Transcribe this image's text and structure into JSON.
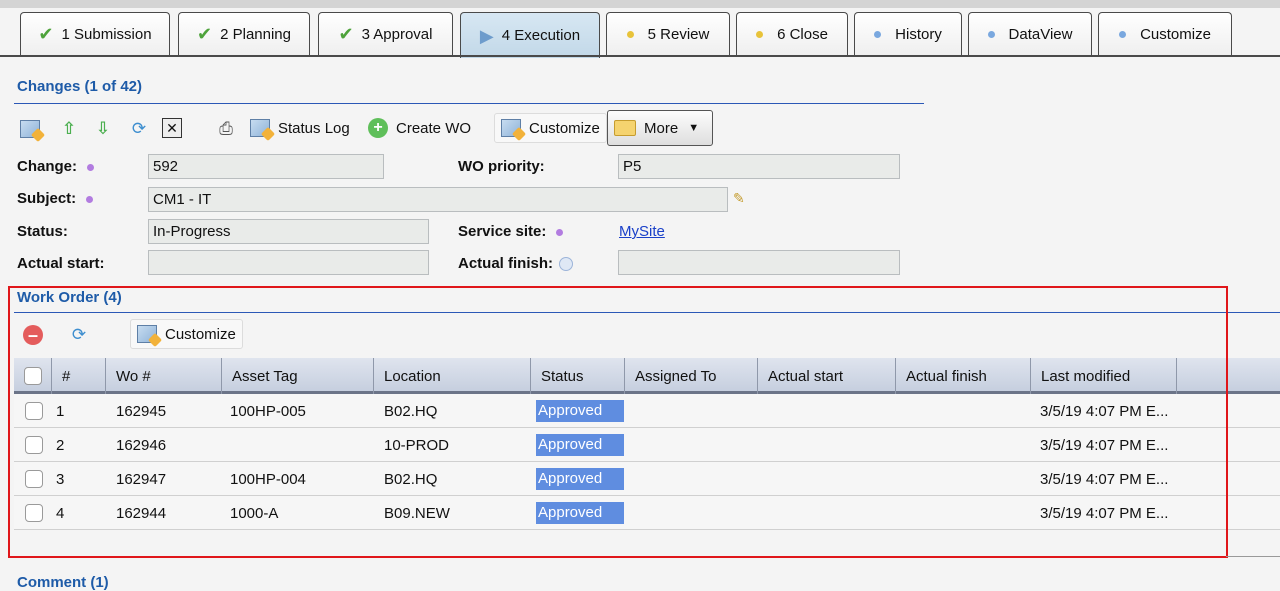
{
  "tabs": [
    {
      "label": "1 Submission",
      "icon": "check-icon"
    },
    {
      "label": "2 Planning",
      "icon": "check-icon"
    },
    {
      "label": "3 Approval",
      "icon": "check-icon"
    },
    {
      "label": "4 Execution",
      "icon": "play-icon"
    },
    {
      "label": "5 Review",
      "icon": "yellow-dot-icon"
    },
    {
      "label": "6 Close",
      "icon": "yellow-dot-icon"
    },
    {
      "label": "History",
      "icon": "blue-dot-icon"
    },
    {
      "label": "DataView",
      "icon": "blue-dot-icon"
    },
    {
      "label": "Customize",
      "icon": "blue-dot-icon"
    }
  ],
  "changes": {
    "title": "Changes (1 of 42)",
    "toolbar": {
      "status_log": "Status Log",
      "create_wo": "Create WO",
      "customize": "Customize",
      "more": "More"
    }
  },
  "form": {
    "change_label": "Change:",
    "change_value": "592",
    "wo_priority_label": "WO priority:",
    "wo_priority_value": "P5",
    "subject_label": "Subject:",
    "subject_value": "CM1 - IT",
    "status_label": "Status:",
    "status_value": "In-Progress",
    "service_site_label": "Service site:",
    "service_site_value": "MySite",
    "actual_start_label": "Actual start:",
    "actual_start_value": "",
    "actual_finish_label": "Actual finish:",
    "actual_finish_value": ""
  },
  "work_order": {
    "title": "Work Order (4)",
    "customize": "Customize",
    "columns": [
      "#",
      "Wo #",
      "Asset Tag",
      "Location",
      "Status",
      "Assigned To",
      "Actual start",
      "Actual finish",
      "Last modified"
    ],
    "rows": [
      {
        "num": "1",
        "wo": "162945",
        "asset": "100HP-005",
        "location": "B02.HQ",
        "status": "Approved",
        "assigned": "",
        "start": "",
        "finish": "",
        "modified": "3/5/19 4:07 PM E..."
      },
      {
        "num": "2",
        "wo": "162946",
        "asset": "",
        "location": "10-PROD",
        "status": "Approved",
        "assigned": "",
        "start": "",
        "finish": "",
        "modified": "3/5/19 4:07 PM E..."
      },
      {
        "num": "3",
        "wo": "162947",
        "asset": "100HP-004",
        "location": "B02.HQ",
        "status": "Approved",
        "assigned": "",
        "start": "",
        "finish": "",
        "modified": "3/5/19 4:07 PM E..."
      },
      {
        "num": "4",
        "wo": "162944",
        "asset": "1000-A",
        "location": "B09.NEW",
        "status": "Approved",
        "assigned": "",
        "start": "",
        "finish": "",
        "modified": "3/5/19 4:07 PM E..."
      }
    ]
  },
  "comment": {
    "title": "Comment (1)"
  },
  "colors": {
    "section_title": "#1e5ba8",
    "status_approved": "#5f8de0",
    "highlight_border": "#e0161a"
  }
}
